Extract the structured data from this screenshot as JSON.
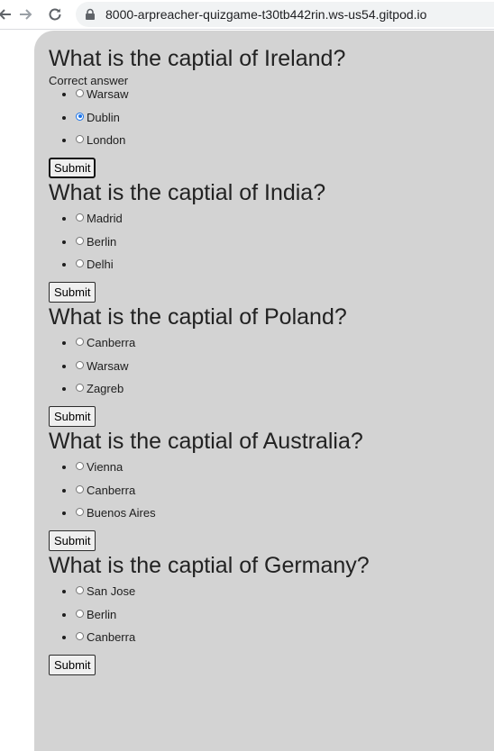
{
  "browser": {
    "url": "8000-arpreacher-quizgame-t30tb442rin.ws-us54.gitpod.io"
  },
  "questions": [
    {
      "title": "What is the captial of Ireland?",
      "feedback": "Correct answer",
      "answers": [
        "Warsaw",
        "Dublin",
        "London"
      ],
      "selected": 1,
      "submit_label": "Submit"
    },
    {
      "title": "What is the captial of India?",
      "answers": [
        "Madrid",
        "Berlin",
        "Delhi"
      ],
      "submit_label": "Submit"
    },
    {
      "title": "What is the captial of Poland?",
      "answers": [
        "Canberra",
        "Warsaw",
        "Zagreb"
      ],
      "submit_label": "Submit"
    },
    {
      "title": "What is the captial of Australia?",
      "answers": [
        "Vienna",
        "Canberra",
        "Buenos Aires"
      ],
      "submit_label": "Submit"
    },
    {
      "title": "What is the captial of Germany?",
      "answers": [
        "San Jose",
        "Berlin",
        "Canberra"
      ],
      "submit_label": "Submit"
    }
  ]
}
